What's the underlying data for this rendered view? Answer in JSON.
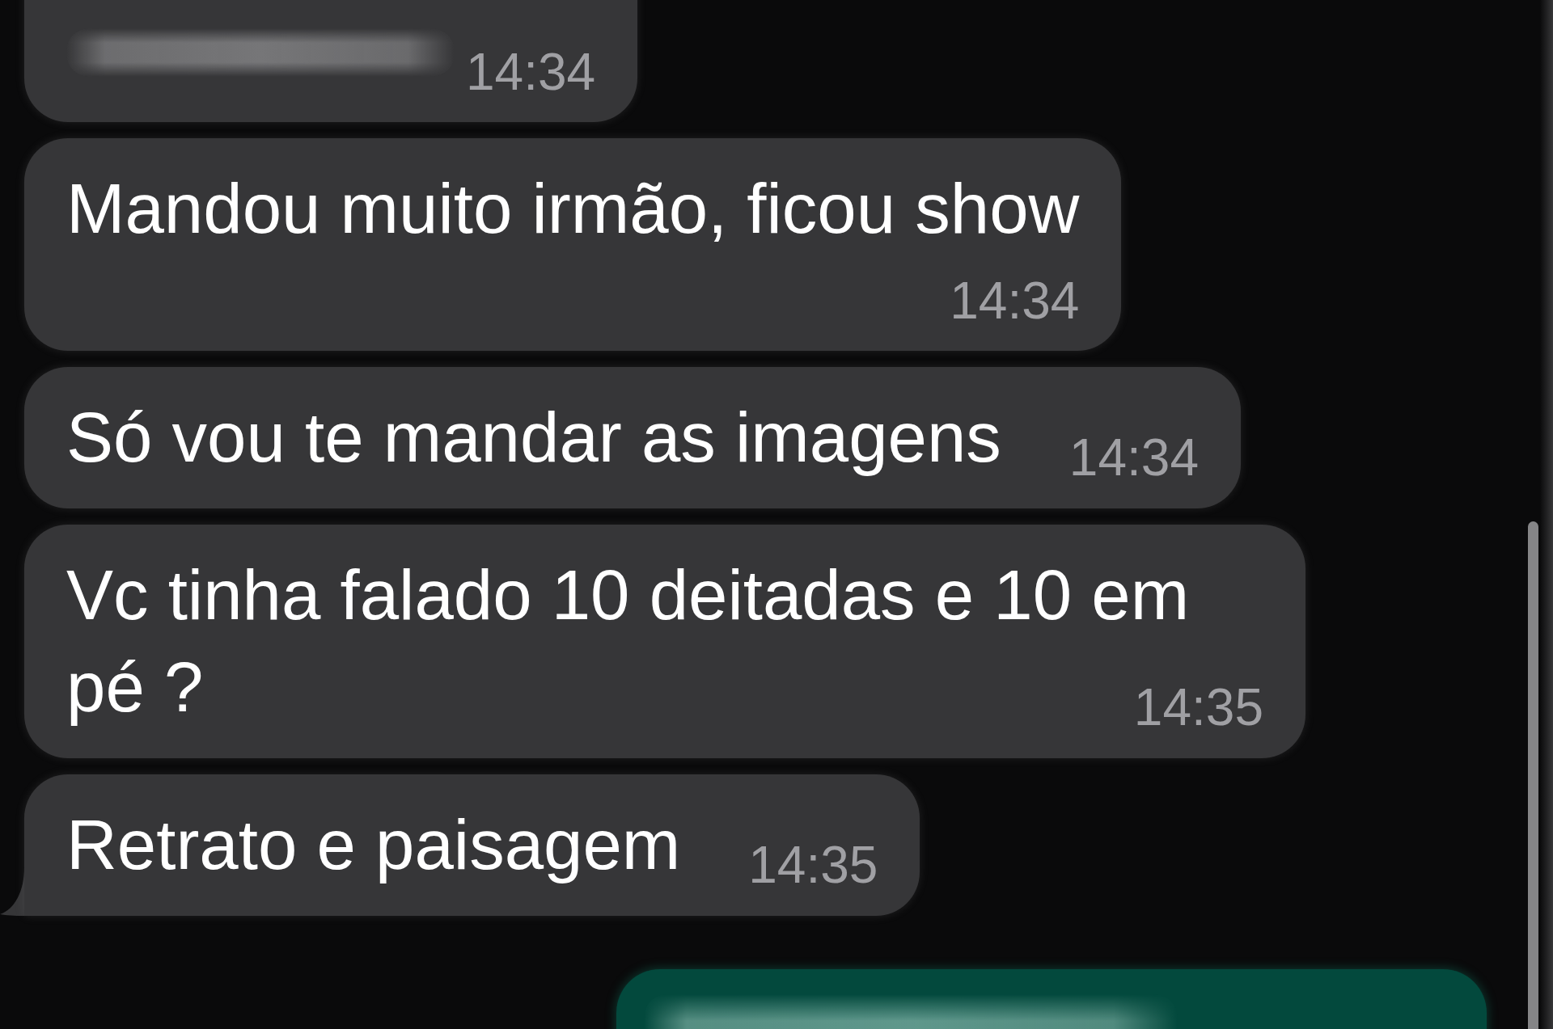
{
  "messages": [
    {
      "kind": "redacted",
      "outgoing": false,
      "time": "14:34",
      "time_on_own_line": false,
      "tail": false
    },
    {
      "kind": "text",
      "outgoing": false,
      "text": "Mandou muito irmão, ficou show",
      "time": "14:34",
      "time_on_own_line": true,
      "tail": false
    },
    {
      "kind": "text",
      "outgoing": false,
      "text": "Só vou te mandar as imagens",
      "time": "14:34",
      "time_on_own_line": false,
      "tail": false
    },
    {
      "kind": "text",
      "outgoing": false,
      "text": "Vc tinha falado 10 deitadas e 10 em pé ?",
      "time": "14:35",
      "time_on_own_line": false,
      "tail": false
    },
    {
      "kind": "text",
      "outgoing": false,
      "text": "Retrato e paisagem",
      "time": "14:35",
      "time_on_own_line": false,
      "tail": true
    },
    {
      "kind": "redacted",
      "outgoing": true,
      "tail": false
    }
  ]
}
